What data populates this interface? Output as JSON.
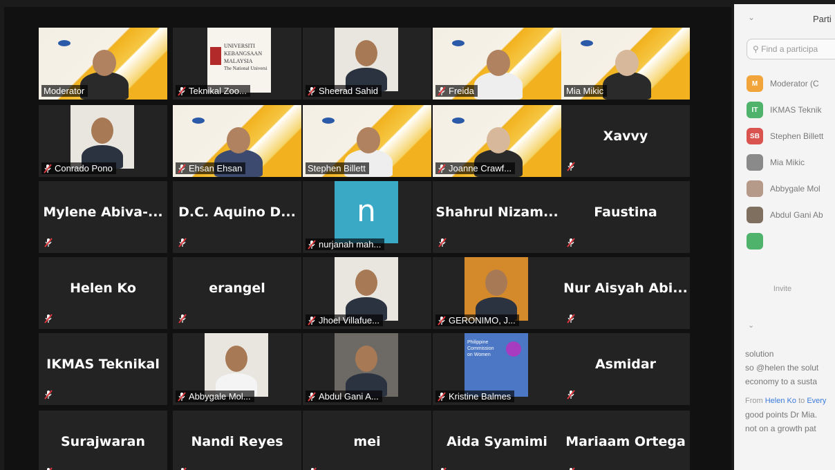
{
  "gallery": {
    "row1": [
      {
        "label": "Moderator",
        "muted": false
      },
      {
        "label": "Teknikal Zoo...",
        "muted": true
      },
      {
        "label": "Sheerad Sahid",
        "muted": true
      },
      {
        "label": "Freida",
        "muted": true
      },
      {
        "label": "Mia Mikic",
        "muted": false
      }
    ],
    "row2": [
      {
        "label": "Conrado Pono",
        "muted": true
      },
      {
        "label": "Ehsan Ehsan",
        "muted": true
      },
      {
        "label": "Stephen Billett",
        "muted": false
      },
      {
        "label": "Joanne Crawf...",
        "muted": true
      },
      {
        "big": "Xavvy"
      }
    ],
    "row3": [
      {
        "big": "Mylene  Abiva-..."
      },
      {
        "big": "D.C. Aquino  D..."
      },
      {
        "label": "nurjanah mah...",
        "avatar_letter": "n"
      },
      {
        "big": "Shahrul  Nizam..."
      },
      {
        "big": "Faustina"
      }
    ],
    "row4": [
      {
        "big": "Helen Ko"
      },
      {
        "big": "erangel"
      },
      {
        "label": "Jhoel Villafue..."
      },
      {
        "label": "GERONIMO, J..."
      },
      {
        "big": "Nur Aisyah Abi..."
      }
    ],
    "row5": [
      {
        "big": "IKMAS Teknikal"
      },
      {
        "label": "Abbygale Mol..."
      },
      {
        "label": "Abdul Gani A..."
      },
      {
        "label": "Kristine Balmes"
      },
      {
        "big": "Asmidar"
      }
    ],
    "row6": [
      {
        "big": "Surajwaran"
      },
      {
        "big": "Nandi Reyes"
      },
      {
        "big": "mei"
      },
      {
        "big": "Aida Syamimi"
      },
      {
        "big": "Mariaam Ortega"
      }
    ],
    "slide_text": {
      "univ_line1": "UNIVERSITI",
      "univ_line2": "KEBANGSAAN",
      "univ_line3": "MALAYSIA",
      "univ_line4": "The National Universi",
      "pcw_line1": "Philippine",
      "pcw_line2": "Commission",
      "pcw_line3": "on Women"
    }
  },
  "panel": {
    "title": "Parti",
    "search_placeholder": "Find a participa",
    "participants": [
      {
        "initials": "M",
        "name": "Moderator (C",
        "color": "#f0a43a"
      },
      {
        "initials": "IT",
        "name": "IKMAS Teknik",
        "color": "#4fb36b"
      },
      {
        "initials": "SB",
        "name": "Stephen Billett",
        "color": "#d9534f"
      },
      {
        "initials": "",
        "name": "Mia Mikic",
        "color": "#8a8a8a"
      },
      {
        "initials": "",
        "name": "Abbygale Mol",
        "color": "#b59a8a"
      },
      {
        "initials": "",
        "name": "Abdul Gani Ab",
        "color": "#7f6f5e"
      },
      {
        "initials": "",
        "name": "",
        "color": "#4fb36b"
      }
    ],
    "invite_label": "Invite",
    "chat": {
      "lines": [
        "solution",
        "so @helen the solut",
        "economy to a susta"
      ],
      "meta_from": "From",
      "meta_sender": "Helen Ko",
      "meta_to": "to",
      "meta_recipient": "Every",
      "lines2": [
        "good points Dr Mia.",
        "not on a growth pat"
      ]
    }
  },
  "colors": {
    "mic_muted": "#e0393e",
    "active_speaker": "#e6e83a",
    "avatar_n": "#39a9c5"
  }
}
